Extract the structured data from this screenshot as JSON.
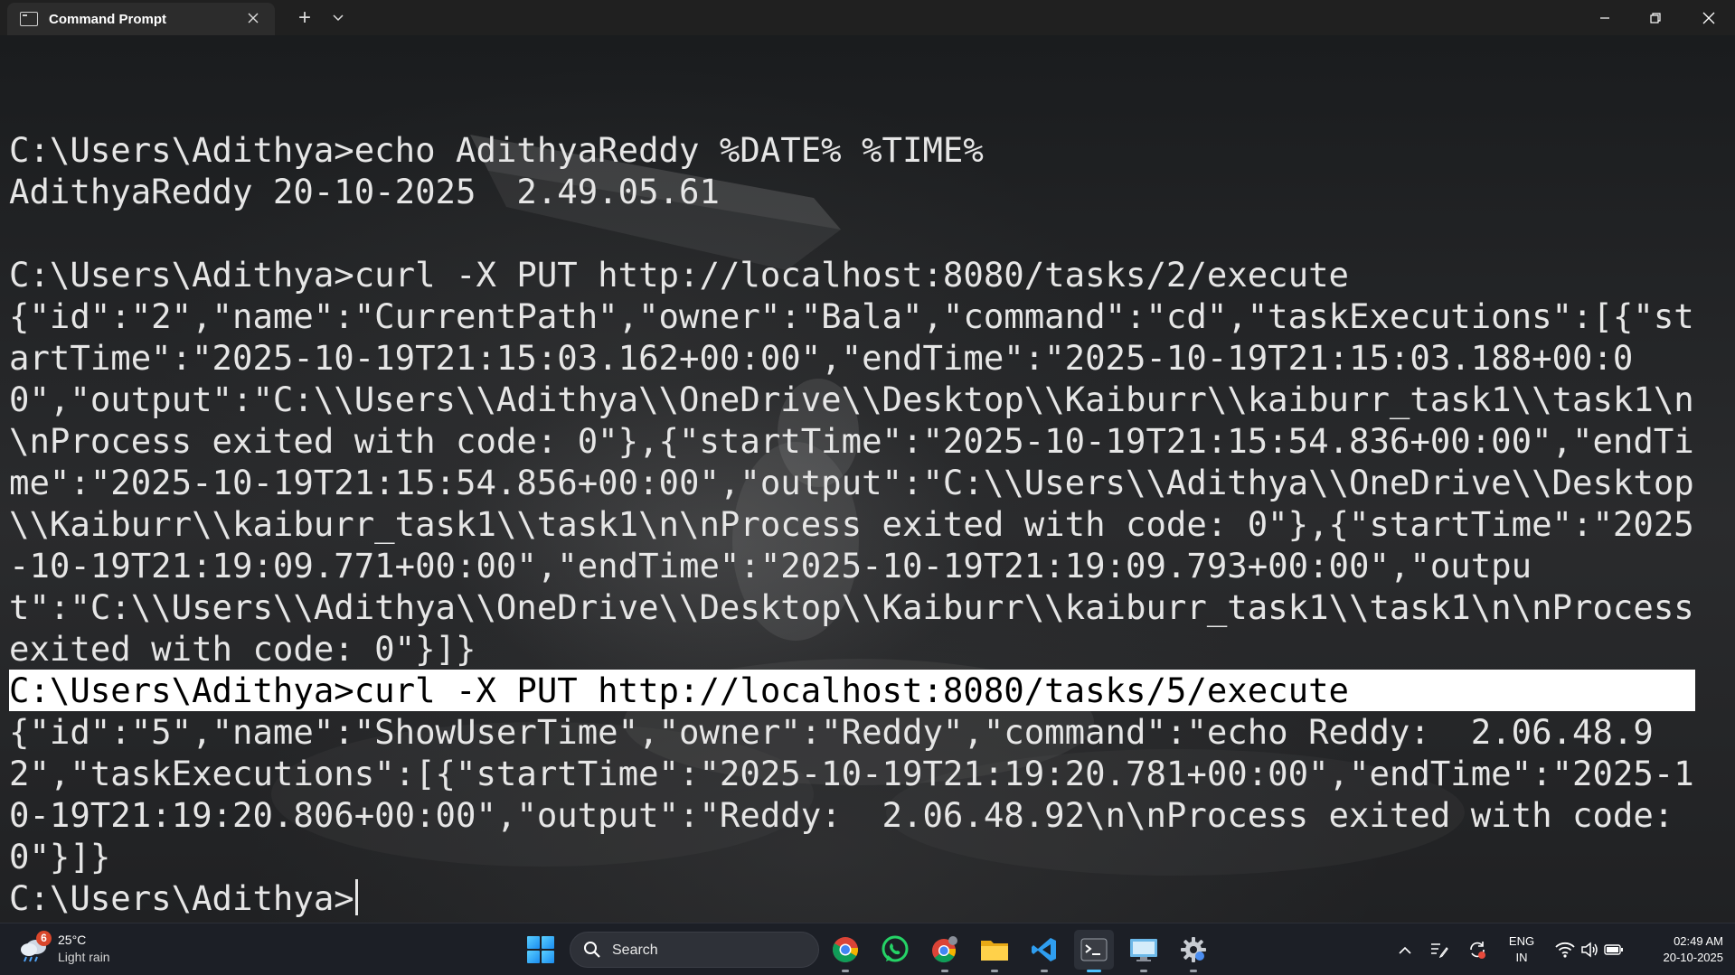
{
  "window": {
    "tab_title": "Command Prompt",
    "tab_icon": "cmd-icon",
    "close_tab_icon": "close-icon",
    "new_tab_glyph": "+",
    "controls": [
      "minimize-icon",
      "maximize-icon",
      "close-icon"
    ]
  },
  "terminal": {
    "lines": [
      {
        "text": "",
        "highlighted": false
      },
      {
        "text": "C:\\Users\\Adithya>echo AdithyaReddy %DATE% %TIME%",
        "highlighted": false
      },
      {
        "text": "AdithyaReddy 20-10-2025  2.49.05.61",
        "highlighted": false
      },
      {
        "text": "",
        "highlighted": false
      },
      {
        "text": "C:\\Users\\Adithya>curl -X PUT http://localhost:8080/tasks/2/execute",
        "highlighted": false
      },
      {
        "text": "{\"id\":\"2\",\"name\":\"CurrentPath\",\"owner\":\"Bala\",\"command\":\"cd\",\"taskExecutions\":[{\"startTime\":\"2025-10-19T21:15:03.162+00:00\",\"endTime\":\"2025-10-19T21:15:03.188+00:00\",\"output\":\"C:\\\\Users\\\\Adithya\\\\OneDrive\\\\Desktop\\\\Kaiburr\\\\kaiburr_task1\\\\task1\\n\\nProcess exited with code: 0\"},{\"startTime\":\"2025-10-19T21:15:54.836+00:00\",\"endTime\":\"2025-10-19T21:15:54.856+00:00\",\"output\":\"C:\\\\Users\\\\Adithya\\\\OneDrive\\\\Desktop\\\\Kaiburr\\\\kaiburr_task1\\\\task1\\n\\nProcess exited with code: 0\"},{\"startTime\":\"2025-10-19T21:19:09.771+00:00\",\"endTime\":\"2025-10-19T21:19:09.793+00:00\",\"output\":\"C:\\\\Users\\\\Adithya\\\\OneDrive\\\\Desktop\\\\Kaiburr\\\\kaiburr_task1\\\\task1\\n\\nProcess exited with code: 0\"}]}",
        "highlighted": false
      },
      {
        "text": "C:\\Users\\Adithya>curl -X PUT http://localhost:8080/tasks/5/execute",
        "highlighted": true
      },
      {
        "text": "{\"id\":\"5\",\"name\":\"ShowUserTime\",\"owner\":\"Reddy\",\"command\":\"echo Reddy:  2.06.48.92\",\"taskExecutions\":[{\"startTime\":\"2025-10-19T21:19:20.781+00:00\",\"endTime\":\"2025-10-19T21:19:20.806+00:00\",\"output\":\"Reddy:  2.06.48.92\\n\\nProcess exited with code: 0\"}]}",
        "highlighted": false
      }
    ],
    "prompt": "C:\\Users\\Adithya>"
  },
  "taskbar": {
    "weather": {
      "badge": "6",
      "temp": "25°C",
      "desc": "Light rain",
      "icon": "weather-rain-icon"
    },
    "search_label": "Search",
    "apps": [
      {
        "name": "chrome",
        "icon": "chrome-icon",
        "running": true,
        "active": false
      },
      {
        "name": "whatsapp",
        "icon": "whatsapp-icon",
        "running": false,
        "active": false
      },
      {
        "name": "chrome-profile",
        "icon": "chrome-profile-icon",
        "running": true,
        "active": false
      },
      {
        "name": "file-explorer",
        "icon": "folder-icon",
        "running": true,
        "active": false
      },
      {
        "name": "vscode",
        "icon": "vscode-icon",
        "running": true,
        "active": false
      },
      {
        "name": "terminal",
        "icon": "terminal-icon",
        "running": true,
        "active": true
      },
      {
        "name": "remote-desktop",
        "icon": "remote-desktop-icon",
        "running": true,
        "active": false
      },
      {
        "name": "settings",
        "icon": "gear-icon",
        "running": true,
        "active": false
      }
    ],
    "tray": {
      "lang_line1": "ENG",
      "lang_line2": "IN",
      "time": "02:49 AM",
      "date": "20-10-2025"
    }
  },
  "colors": {
    "titlebar_bg": "#202020",
    "terminal_text": "#e6e6e6",
    "highlight_bg": "#ffffff",
    "taskbar_bg": "#1c1f26",
    "accent": "#4cc2ff"
  }
}
